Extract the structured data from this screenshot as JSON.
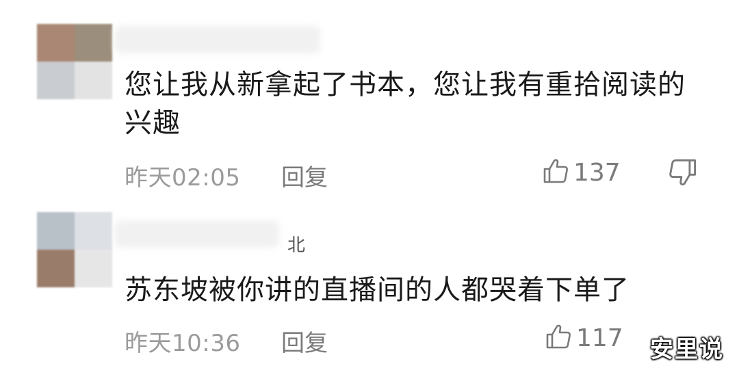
{
  "comments": [
    {
      "text": "您让我从新拿起了书本，您让我有重拾阅读的兴趣",
      "time": "昨天02:05",
      "reply_label": "回复",
      "likes": "137"
    },
    {
      "location": "北",
      "text": "苏东坡被你讲的直播间的人都哭着下单了",
      "time": "昨天10:36",
      "reply_label": "回复",
      "likes": "117"
    }
  ],
  "watermark": "安里说",
  "icons": {
    "like": "thumbs-up-icon",
    "dislike": "thumbs-down-icon"
  },
  "colors": {
    "text": "#1a1a1a",
    "meta": "#9b9b9b",
    "action": "#7a7a7a"
  }
}
